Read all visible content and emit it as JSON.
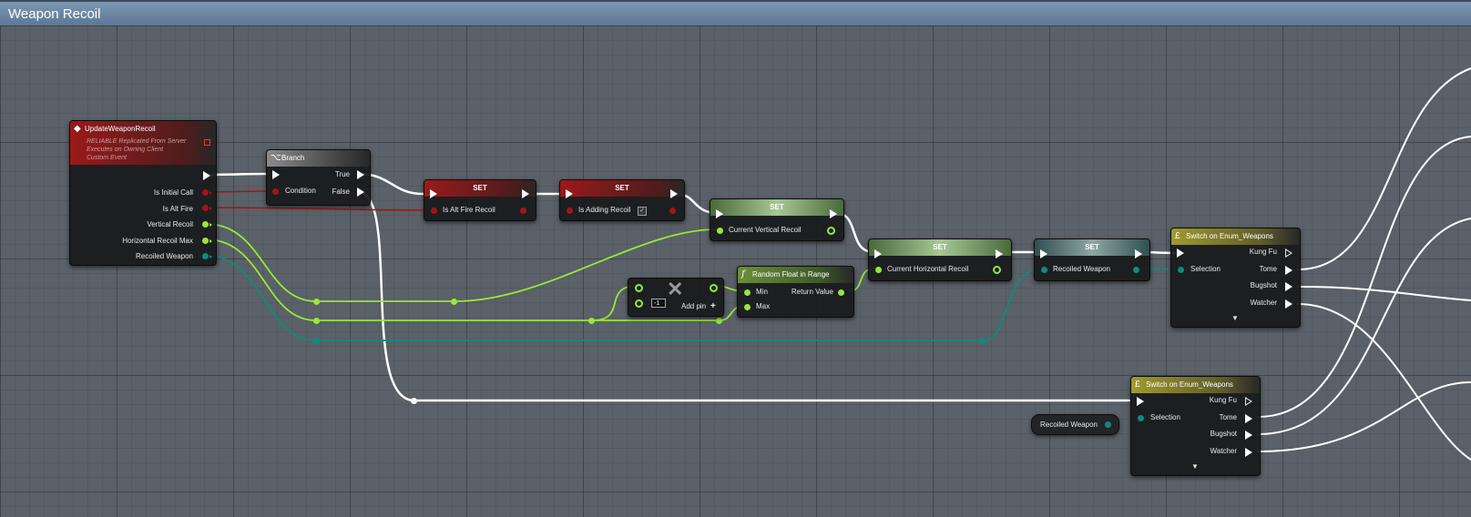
{
  "graph": {
    "title": "Weapon Recoil"
  },
  "event_node": {
    "title": "UpdateWeaponRecoil",
    "subtitle_lines": [
      "RELIABLE Replicated From Server",
      "Executes on Owning Client",
      "Custom Event"
    ],
    "outputs": [
      "Is Initial Call",
      "Is Alt Fire",
      "Vertical Recoil",
      "Horizontal Recoil Max",
      "Recoiled Weapon"
    ]
  },
  "branch_node": {
    "title": "Branch",
    "input": "Condition",
    "true_label": "True",
    "false_label": "False"
  },
  "set_alt_fire": {
    "title": "SET",
    "pin": "Is Alt Fire Recoil"
  },
  "set_adding": {
    "title": "SET",
    "pin": "Is Adding Recoil",
    "checked": "✓"
  },
  "set_vertical": {
    "title": "SET",
    "pin": "Current Vertical Recoil"
  },
  "set_horizontal": {
    "title": "SET",
    "pin": "Current Horizontal Recoil"
  },
  "set_weapon": {
    "title": "SET",
    "pin": "Recoiled Weapon"
  },
  "multiply_node": {
    "value": "-1",
    "add_pin": "Add pin",
    "add_icon": "+"
  },
  "random_node": {
    "title": "Random Float in Range",
    "min": "Min",
    "max": "Max",
    "return": "Return Value"
  },
  "switch_top": {
    "title": "Switch on Enum_Weapons",
    "selection": "Selection",
    "outputs": [
      "Kung Fu",
      "Tome",
      "Bugshot",
      "Watcher"
    ]
  },
  "switch_bottom": {
    "title": "Switch on Enum_Weapons",
    "selection": "Selection",
    "outputs": [
      "Kung Fu",
      "Tome",
      "Bugshot",
      "Watcher"
    ]
  },
  "get_weapon": {
    "label": "Recoiled Weapon"
  },
  "icons": {
    "branch": "branch-icon",
    "function": "function-icon",
    "switch": "switch-icon",
    "event": "event-icon",
    "remove": "x-icon"
  },
  "colors": {
    "exec": "#ffffff",
    "bool": "#a51414",
    "float": "#9ae63a",
    "enum": "#108a7c"
  }
}
